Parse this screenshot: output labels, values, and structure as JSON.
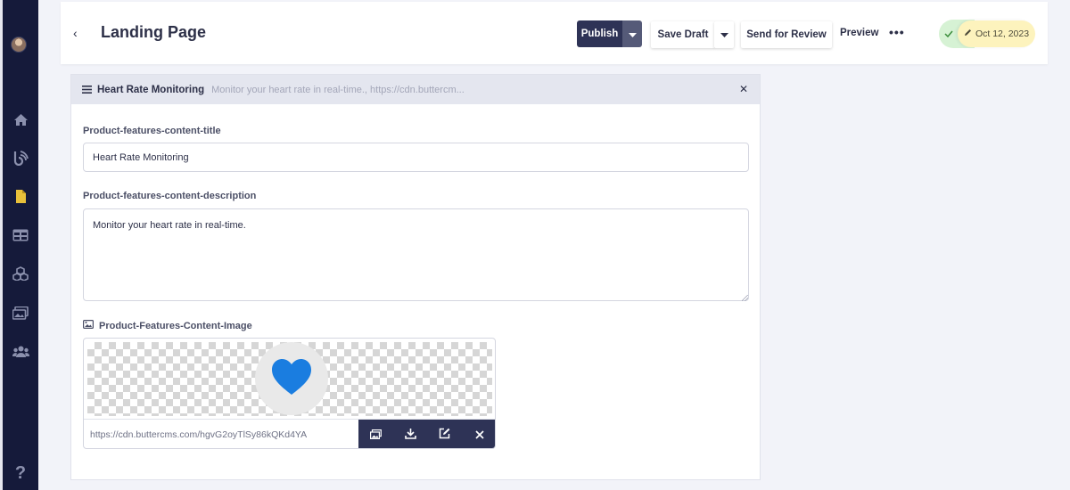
{
  "header": {
    "back_symbol": "‹",
    "title": "Landing Page",
    "publish_label": "Publish",
    "save_draft_label": "Save Draft",
    "send_review_label": "Send for Review",
    "preview_label": "Preview",
    "more_label": "•••",
    "status_date": "Oct 12, 2023"
  },
  "sidebar": {
    "icons": [
      "home-icon",
      "blog-icon",
      "page-icon",
      "collections-icon",
      "components-icon",
      "media-icon",
      "users-icon"
    ],
    "help_label": "?"
  },
  "panel": {
    "title": "Heart Rate Monitoring",
    "subtitle": "Monitor your heart rate in real-time., https://cdn.buttercm...",
    "close_label": "✕",
    "fields": {
      "title_label": "Product-features-content-title",
      "title_value": "Heart Rate Monitoring",
      "description_label": "Product-features-content-description",
      "description_value": "Monitor your heart rate in real-time.",
      "image_label": "Product-Features-Content-Image",
      "image_url": "https://cdn.buttercms.com/hgvG2oyTlSy86kQKd4YA"
    }
  },
  "colors": {
    "sidebar_bg": "#151a3a",
    "publish_bg": "#2e3356",
    "heart": "#1a7de0",
    "status_green": "#d6f2d4",
    "status_yellow": "#fdf3bd"
  }
}
